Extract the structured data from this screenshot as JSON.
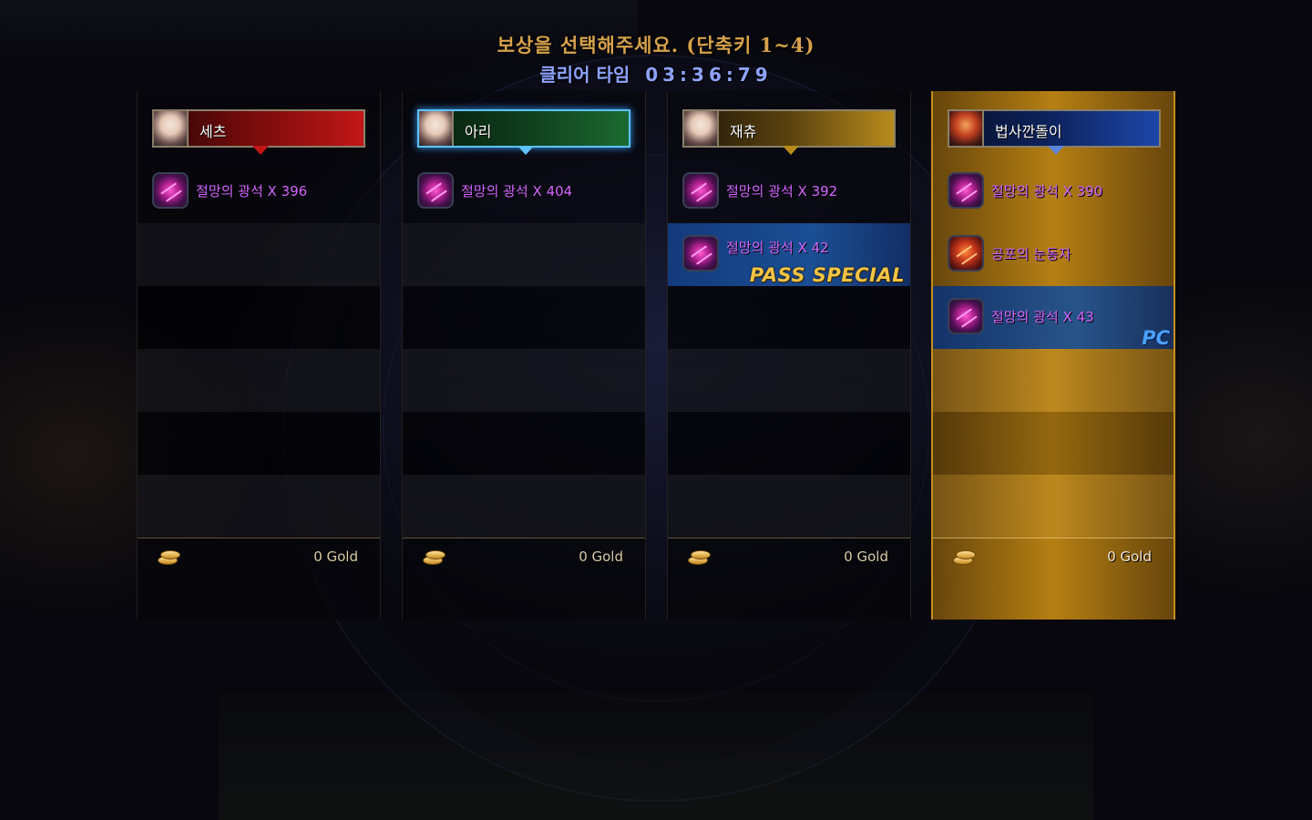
{
  "header": {
    "title": "보상을 선택해주세요. (단축키 1~4)",
    "clear_label": "클리어 타임",
    "clear_time": "03:36:79"
  },
  "columns": [
    {
      "player_name": "세츠",
      "plate_color": "#c21616",
      "items": [
        {
          "text": "절망의 광석 X 396"
        }
      ],
      "gold": "0 Gold"
    },
    {
      "player_name": "아리",
      "plate_color": "#1c6a30",
      "items": [
        {
          "text": "절망의 광석 X 404"
        }
      ],
      "gold": "0 Gold"
    },
    {
      "player_name": "재츄",
      "plate_color": "#b88b1c",
      "items": [
        {
          "text": "절망의 광석 X 392"
        },
        {
          "text": "절망의 광석 X 42",
          "badge": "PASS SPECIAL"
        }
      ],
      "gold": "0 Gold"
    },
    {
      "player_name": "법사깐돌이",
      "plate_color": "#1d46a8",
      "selected": true,
      "items": [
        {
          "text": "절망의 광석 X 390"
        },
        {
          "text": "공포의 눈동자"
        },
        {
          "text": "절망의 광석 X 43",
          "badge": "PC"
        }
      ],
      "gold": "0 Gold"
    }
  ]
}
